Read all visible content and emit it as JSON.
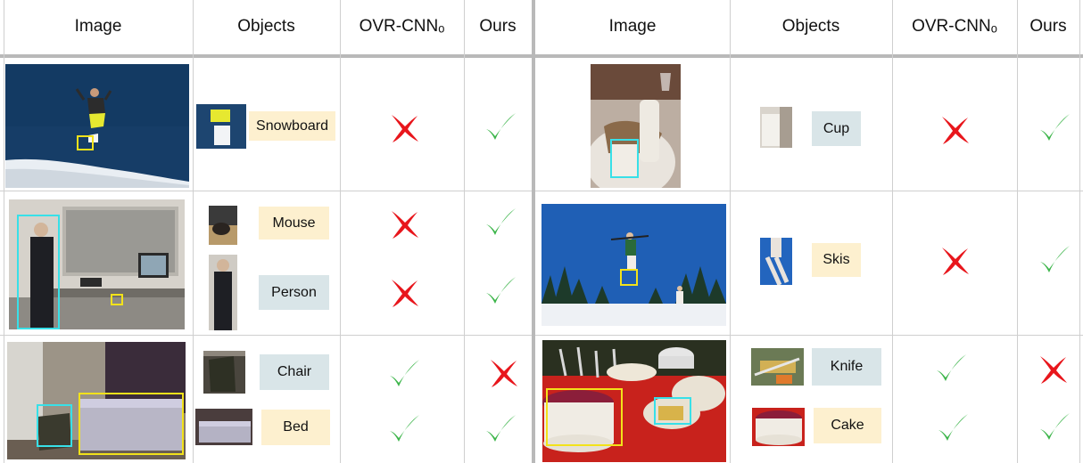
{
  "headers": {
    "image_left": "Image",
    "objects_left": "Objects",
    "baseline_left": "OVR-CNNₒ",
    "ours_left": "Ours",
    "image_right": "Image",
    "objects_right": "Objects",
    "baseline_right": "OVR-CNNₒ",
    "ours_right": "Ours"
  },
  "labels": {
    "snowboard": "Snowboard",
    "cup": "Cup",
    "mouse": "Mouse",
    "person": "Person",
    "skis": "Skis",
    "chair": "Chair",
    "bed": "Bed",
    "knife": "Knife",
    "cake": "Cake"
  },
  "colors": {
    "check": "#3cb54a",
    "cross": "#e8161c",
    "tan_label": "#fdf0cf",
    "blue_label": "#d9e5e8",
    "yellow_box": "#f2e21a",
    "cyan_box": "#38e0e8"
  },
  "results": [
    {
      "object": "Snowboard",
      "baseline": "cross-icon",
      "ours": "check-icon"
    },
    {
      "object": "Cup",
      "baseline": "cross-icon",
      "ours": "check-icon"
    },
    {
      "object": "Mouse",
      "baseline": "cross-icon",
      "ours": "check-icon"
    },
    {
      "object": "Person",
      "baseline": "cross-icon",
      "ours": "check-icon"
    },
    {
      "object": "Skis",
      "baseline": "cross-icon",
      "ours": "check-icon"
    },
    {
      "object": "Chair",
      "baseline": "check-icon",
      "ours": "cross-icon"
    },
    {
      "object": "Bed",
      "baseline": "check-icon",
      "ours": "check-icon"
    },
    {
      "object": "Knife",
      "baseline": "check-icon",
      "ours": "cross-icon"
    },
    {
      "object": "Cake",
      "baseline": "check-icon",
      "ours": "check-icon"
    }
  ]
}
